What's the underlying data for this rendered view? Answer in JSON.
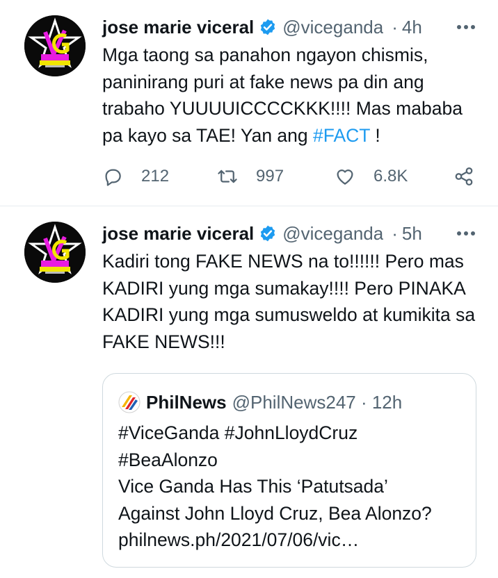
{
  "colors": {
    "accent": "#1d9bf0",
    "verified": "#1d9bf0",
    "muted": "#536471",
    "text": "#0f1419"
  },
  "tweets": [
    {
      "author_name": "jose marie viceral",
      "author_handle": "@viceganda",
      "time": "4h",
      "avatar_icon": "vice-ganda-network-logo",
      "body_before": "Mga taong sa panahon ngayon chismis, paninirang puri at fake news pa din ang trabaho YUUUUICCCCKKK!!!! Mas mababa pa kayo sa TAE!  Yan ang ",
      "hashtag": "#FACT",
      "body_after": " !",
      "replies": "212",
      "retweets": "997",
      "likes": "6.8K"
    },
    {
      "author_name": "jose marie viceral",
      "author_handle": "@viceganda",
      "time": "5h",
      "avatar_icon": "vice-ganda-network-logo",
      "body": "Kadiri tong FAKE NEWS na to!!!!!! Pero mas KADIRI yung mga sumakay!!!!  Pero PINAKA KADIRI yung mga sumusweldo at kumikita sa FAKE NEWS!!!",
      "quote": {
        "source_name": "PhilNews",
        "source_handle": "@PhilNews247",
        "time": "12h",
        "logo_icon": "philnews-logo",
        "lines": [
          "#ViceGanda #JohnLloydCruz",
          "#BeaAlonzo",
          "Vice Ganda Has This ‘Patutsada’",
          "Against John Lloyd Cruz, Bea Alonzo?",
          "philnews.ph/2021/07/06/vic…"
        ]
      }
    }
  ]
}
